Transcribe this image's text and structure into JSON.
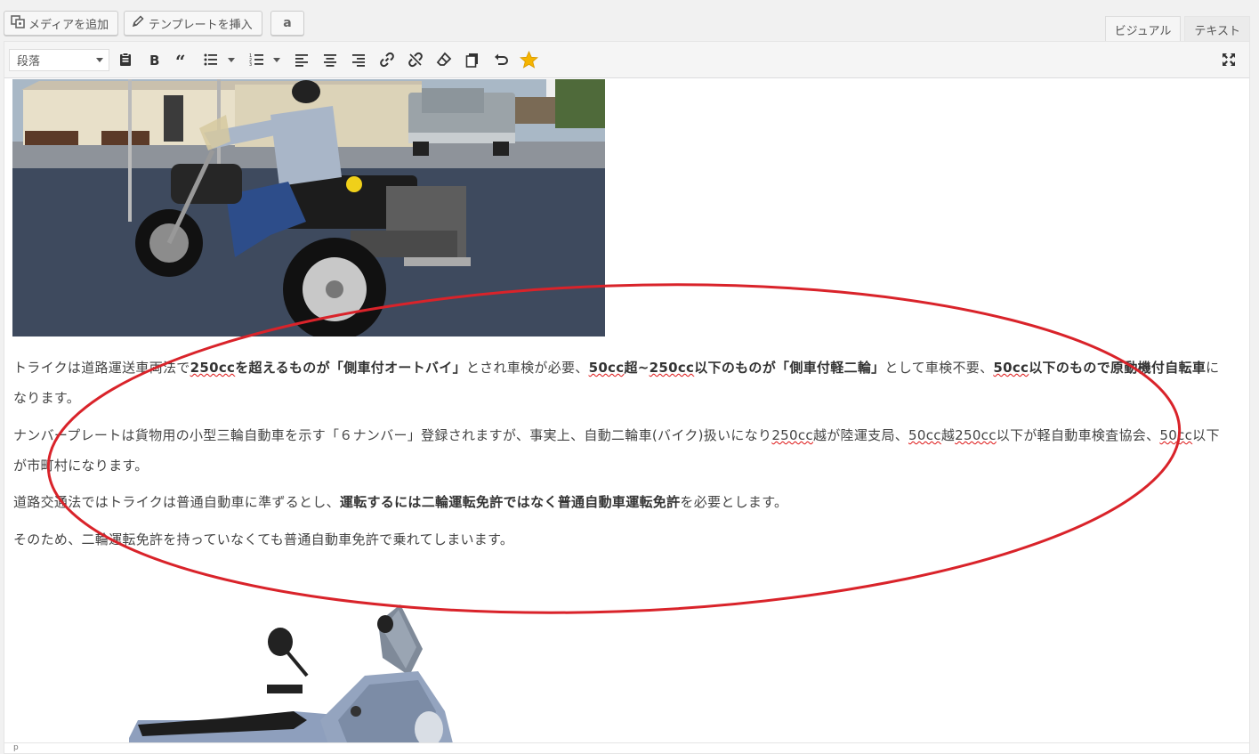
{
  "media_buttons": {
    "add_media": "メディアを追加",
    "insert_template": "テンプレートを挿入",
    "amazon": "a"
  },
  "tabs": {
    "visual": "ビジュアル",
    "text": "テキスト"
  },
  "toolbar": {
    "format_value": "段落",
    "icons": [
      "paste-icon",
      "bold-icon",
      "blockquote-icon",
      "bullet-list-icon",
      "numbered-list-icon",
      "align-left-icon",
      "align-center-icon",
      "align-right-icon",
      "link-icon",
      "unlink-icon",
      "eraser-icon",
      "copy-icon",
      "undo-icon",
      "star-icon",
      "fullscreen-icon"
    ]
  },
  "content": {
    "p1": {
      "t1": "トライクは道路運送車両法で",
      "b1": "250cc",
      "b2": "を超えるものが「側車付オートバイ」",
      "t2": "とされ車検が必要、",
      "b3": "50cc",
      "b4": "超~",
      "b5": "250cc",
      "b6": "以下のものが「側車付軽二輪」",
      "t3": "として車検不要、",
      "b7": "50cc",
      "b8": "以下のもので原動機付自転車",
      "t4": "になります。"
    },
    "p2": {
      "t1": "ナンバープレートは貨物用の小型三輪自動車を示す「６ナンバー」登録されますが、事実上、自動二輪車(バイク)扱いになり",
      "s1": "250cc",
      "t2": "越が陸運支局、",
      "s2": "50cc",
      "t3": "越",
      "s3": "250cc",
      "t4": "以下が軽自動車検査協会、",
      "s4": "50cc",
      "t5": "以下が市町村になります。"
    },
    "p3": {
      "t1": "道路交通法ではトライクは普通自動車に準ずるとし、",
      "b1": "運転するには二輪運転免許ではなく普通自動車運転免許",
      "t2": "を必要とします。"
    },
    "p4": "そのため、二輪運転免許を持っていなくても普通自動車免許で乗れてしまいます。"
  },
  "statusbar": "p",
  "colors": {
    "annotation": "#d9232a",
    "star": "#f5b400"
  }
}
